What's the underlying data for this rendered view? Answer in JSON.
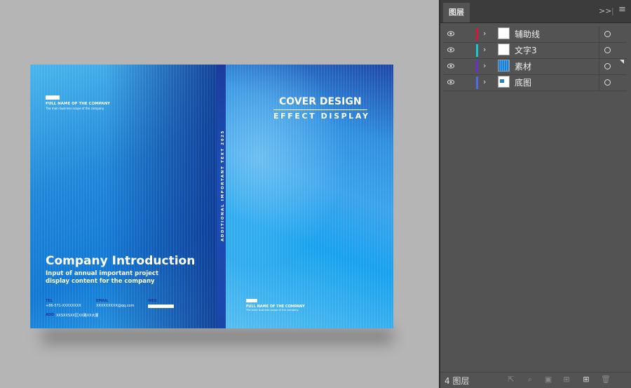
{
  "artboard": {
    "back_cover": {
      "company_full_name": "FULL NAME OF THE COMPANY",
      "company_scope": "The main business scope of the company",
      "title": "Company Introduction",
      "subtitle_line1": "Input of annual important project",
      "subtitle_line2": "display content for the company",
      "tel_label": "TEL",
      "tel_value": "+86-571-XXXXXXXX",
      "email_label": "EMAIL",
      "email_value": "XXXXXXXXX@qq.com",
      "web_label": "WEB",
      "address_label": "ADD",
      "address_value": "XXSXXSXX区XX路XX大厦"
    },
    "spine": {
      "text": "ADDITIONAL IMPORTANT TEXT 2025"
    },
    "front_cover": {
      "title": "COVER DESIGN",
      "subtitle": "EFFECT DISPLAY",
      "company_full_name": "FULL NAME OF THE COMPANY",
      "company_scope": "The main business scope of the company"
    }
  },
  "layers_panel": {
    "tab_label": "图层",
    "expand_icon": "double-chevron-right",
    "menu_icon": "hamburger-menu",
    "layers": [
      {
        "name": "辅助线",
        "color": "#d6173b",
        "thumb": "blank"
      },
      {
        "name": "文字3",
        "color": "#17c7d3",
        "thumb": "blank"
      },
      {
        "name": "素材",
        "color": "#6b2fd0",
        "thumb": "blue-pattern"
      },
      {
        "name": "底图",
        "color": "#4b6fe0",
        "thumb": "blue-corner"
      }
    ],
    "footer": {
      "layer_count": "4 图层",
      "icons": [
        "export-icon",
        "search-icon",
        "clipping-mask-icon",
        "sublayer-icon",
        "new-layer-icon",
        "trash-icon"
      ]
    }
  }
}
